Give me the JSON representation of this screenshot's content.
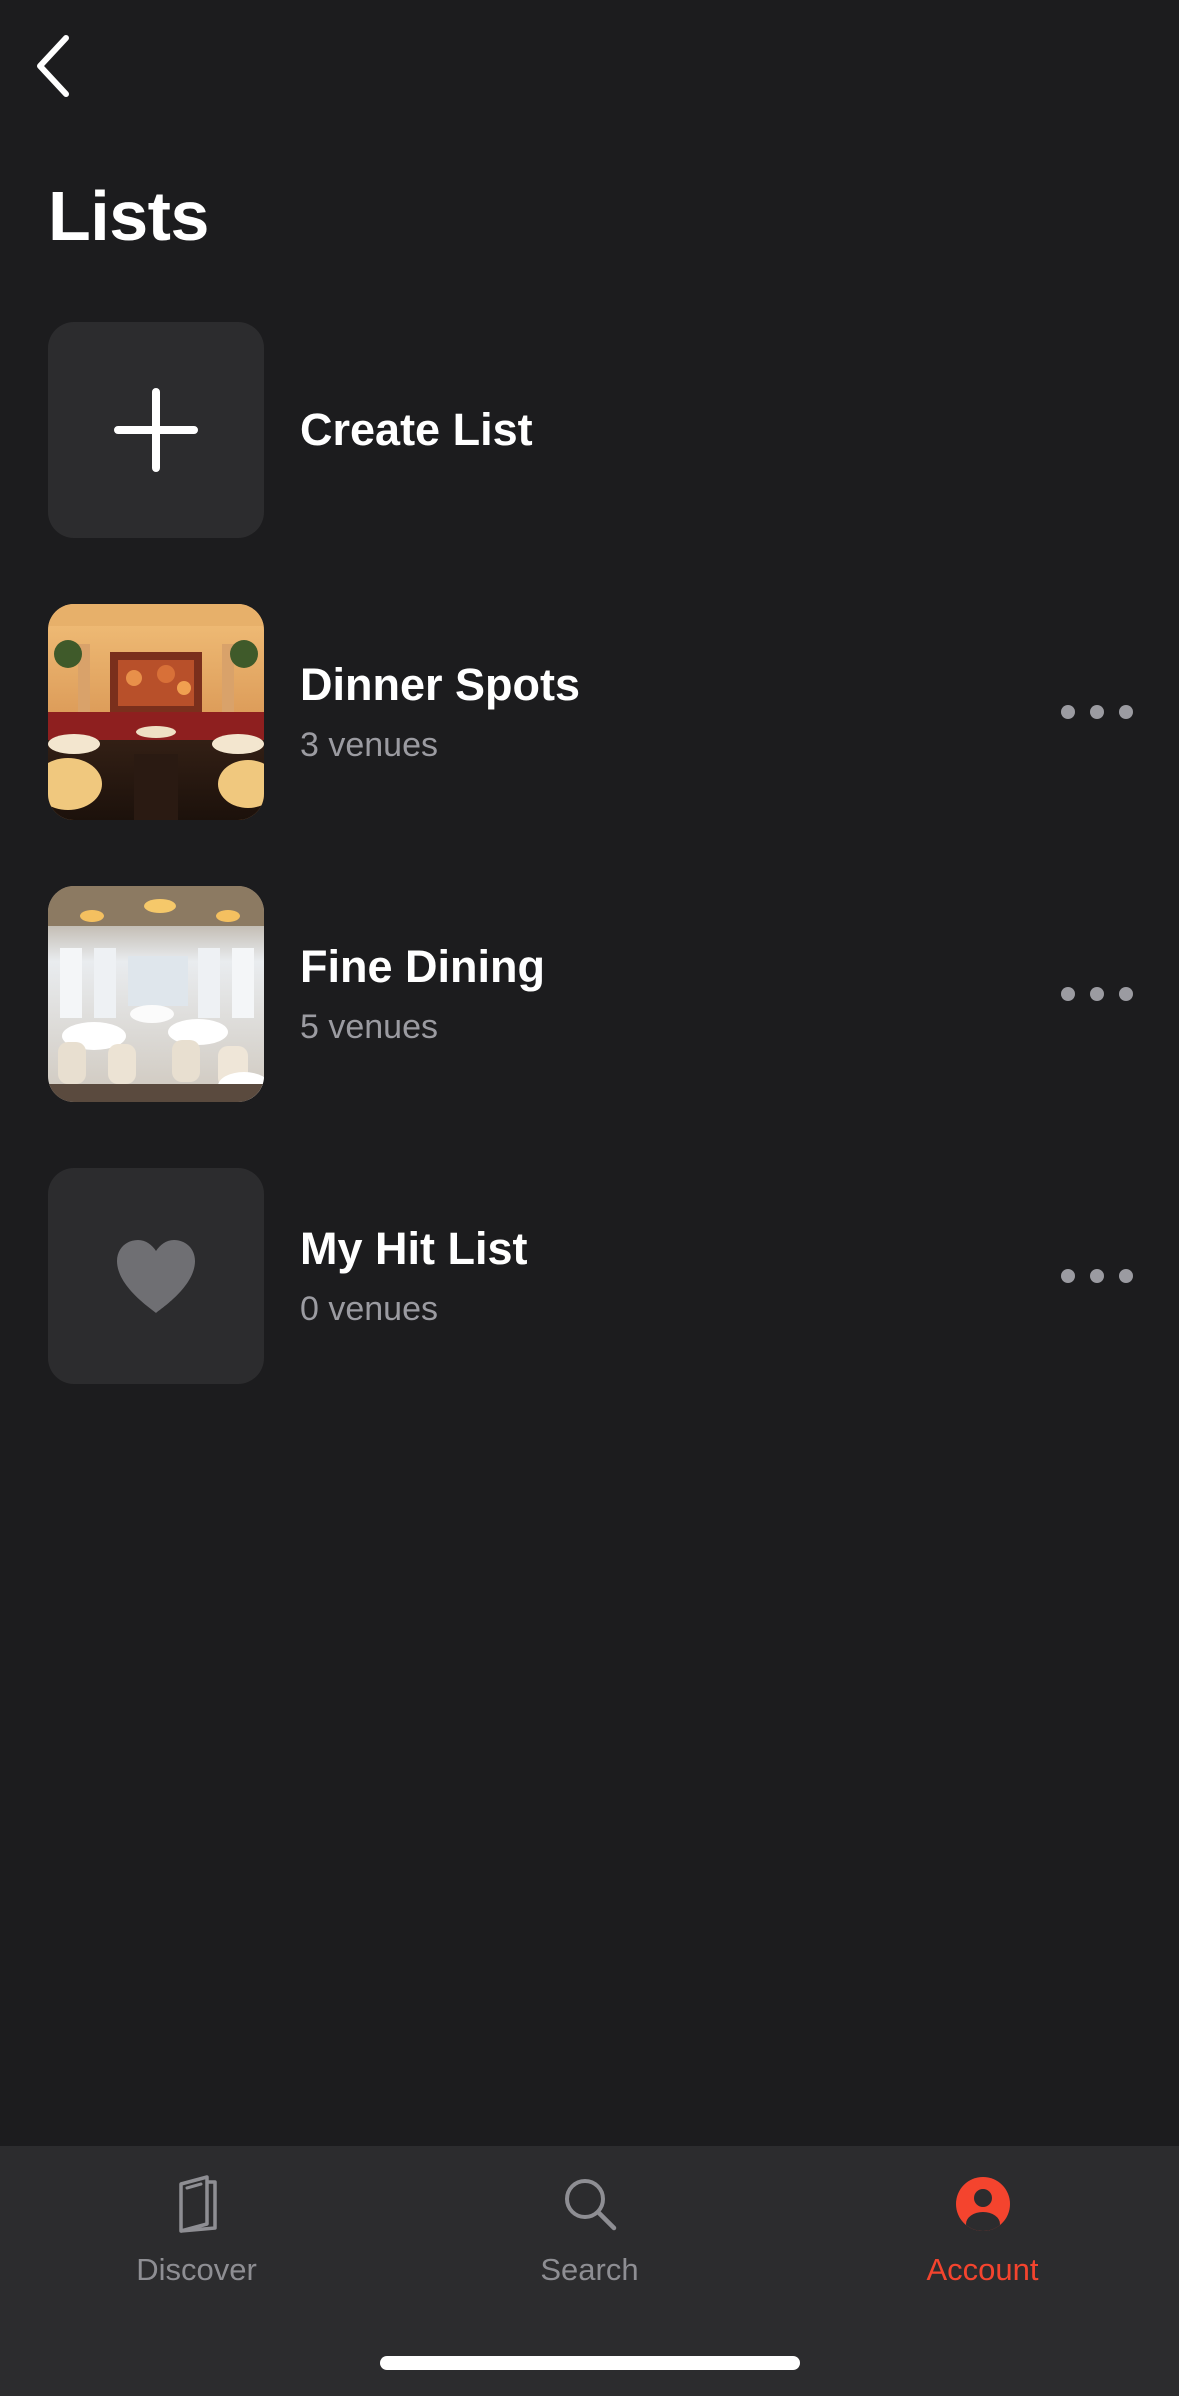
{
  "header": {
    "title": "Lists"
  },
  "lists": [
    {
      "title": "Create List",
      "subtitle": "",
      "thumbnail": "plus-icon"
    },
    {
      "title": "Dinner Spots",
      "subtitle": "3 venues",
      "thumbnail": "dinner-spots-photo"
    },
    {
      "title": "Fine Dining",
      "subtitle": "5 venues",
      "thumbnail": "fine-dining-photo"
    },
    {
      "title": "My Hit List",
      "subtitle": "0 venues",
      "thumbnail": "heart-icon"
    }
  ],
  "tabbar": {
    "tabs": [
      {
        "label": "Discover",
        "icon": "book-icon",
        "active": false
      },
      {
        "label": "Search",
        "icon": "search-icon",
        "active": false
      },
      {
        "label": "Account",
        "icon": "account-icon",
        "active": true
      }
    ]
  },
  "colors": {
    "background": "#1c1c1e",
    "surface": "#2c2c2e",
    "accent": "#f4442e",
    "secondary_text": "#9b9ba1"
  }
}
